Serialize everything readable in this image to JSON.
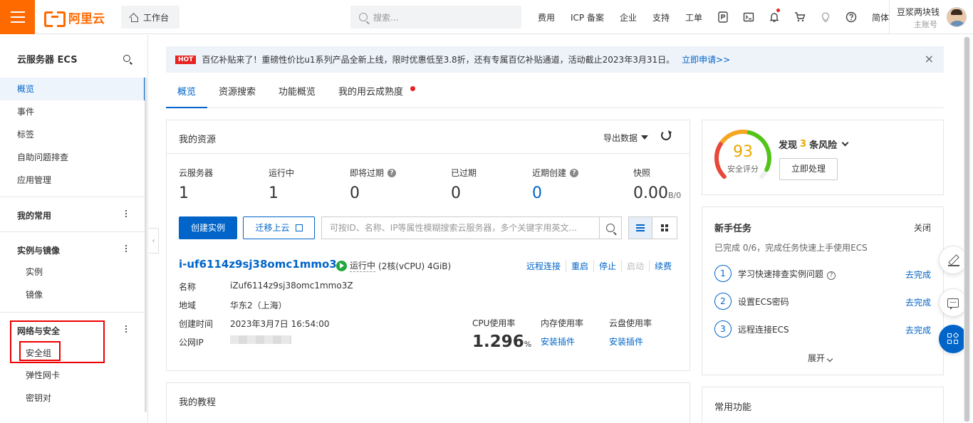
{
  "header": {
    "logo_text": "阿里云",
    "workbench": "工作台",
    "search_placeholder": "搜索...",
    "links": [
      "费用",
      "ICP 备案",
      "企业",
      "支持",
      "工单"
    ],
    "lang": "简体",
    "user_name": "豆浆两块钱",
    "user_sub": "主账号"
  },
  "sidebar": {
    "title": "云服务器 ECS",
    "items": [
      "概览",
      "事件",
      "标签",
      "自助问题排查",
      "应用管理"
    ],
    "groups": {
      "common": "我的常用",
      "instance_image": "实例与镜像",
      "network_security": "网络与安全"
    },
    "instance_items": [
      "实例",
      "镜像"
    ],
    "network_items": [
      "安全组",
      "弹性网卡",
      "密钥对"
    ]
  },
  "banner": {
    "hot": "HOT",
    "text": "百亿补贴来了！重磅性价比u1系列产品全新上线，限时优惠低至3.8折，还有专属百亿补贴通道，活动截止2023年3月31日。",
    "link": "立即申请>>",
    "close": "×"
  },
  "tabs": [
    "概览",
    "资源搜索",
    "功能概览",
    "我的用云成熟度"
  ],
  "resources": {
    "title": "我的资源",
    "export": "导出数据",
    "stats": [
      {
        "label": "云服务器",
        "value": "1"
      },
      {
        "label": "运行中",
        "value": "1"
      },
      {
        "label": "即将过期",
        "value": "0"
      },
      {
        "label": "已过期",
        "value": "0"
      },
      {
        "label": "近期创建",
        "value": "0"
      },
      {
        "label": "快照",
        "value": "0.00",
        "unit": "B/0"
      }
    ],
    "create_btn": "创建实例",
    "migrate_btn": "迁移上云",
    "search_placeholder": "可按ID、名称、IP等属性模糊搜索云服务器，多个关键字用英文...",
    "instance": {
      "id": "i-uf6114z9sj38omc1mmo3",
      "status": "运行中",
      "spec": "(2核(vCPU) 4GiB)",
      "actions": [
        "远程连接",
        "重启",
        "停止",
        "启动",
        "续费"
      ],
      "labels": {
        "name": "名称",
        "region": "地域",
        "created": "创建时间",
        "ip": "公网IP"
      },
      "name": "iZuf6114z9sj38omc1mmo3Z",
      "region": "华东2（上海）",
      "created": "2023年3月7日 16:54:00",
      "cpu_label": "CPU使用率",
      "mem_label": "内存使用率",
      "disk_label": "云盘使用率",
      "cpu_value": "1.296",
      "cpu_unit": "%",
      "install": "安装插件"
    }
  },
  "tutorial": {
    "title": "我的教程"
  },
  "security": {
    "score": "93",
    "score_label": "安全评分",
    "risk_prefix": "发现",
    "risk_count": "3",
    "risk_suffix": "条风险",
    "handle_btn": "立即处理",
    "score_fraction": 0.93,
    "gauge_colors": [
      "#e8483a",
      "#f5a623",
      "#52c41a"
    ]
  },
  "tasks": {
    "title": "新手任务",
    "close": "关闭",
    "subtitle": "已完成 0/6，完成任务快速上手使用ECS",
    "items": [
      {
        "num": "1",
        "label": "学习快速排查实例问题",
        "link": "去完成"
      },
      {
        "num": "2",
        "label": "设置ECS密码",
        "link": "去完成"
      },
      {
        "num": "3",
        "label": "远程连接ECS",
        "link": "去完成"
      }
    ],
    "expand": "展开"
  },
  "common_functions": {
    "title": "常用功能"
  },
  "colors": {
    "brand": "#ff6a00",
    "primary": "#0064c8",
    "highlight": "#ee0000"
  }
}
